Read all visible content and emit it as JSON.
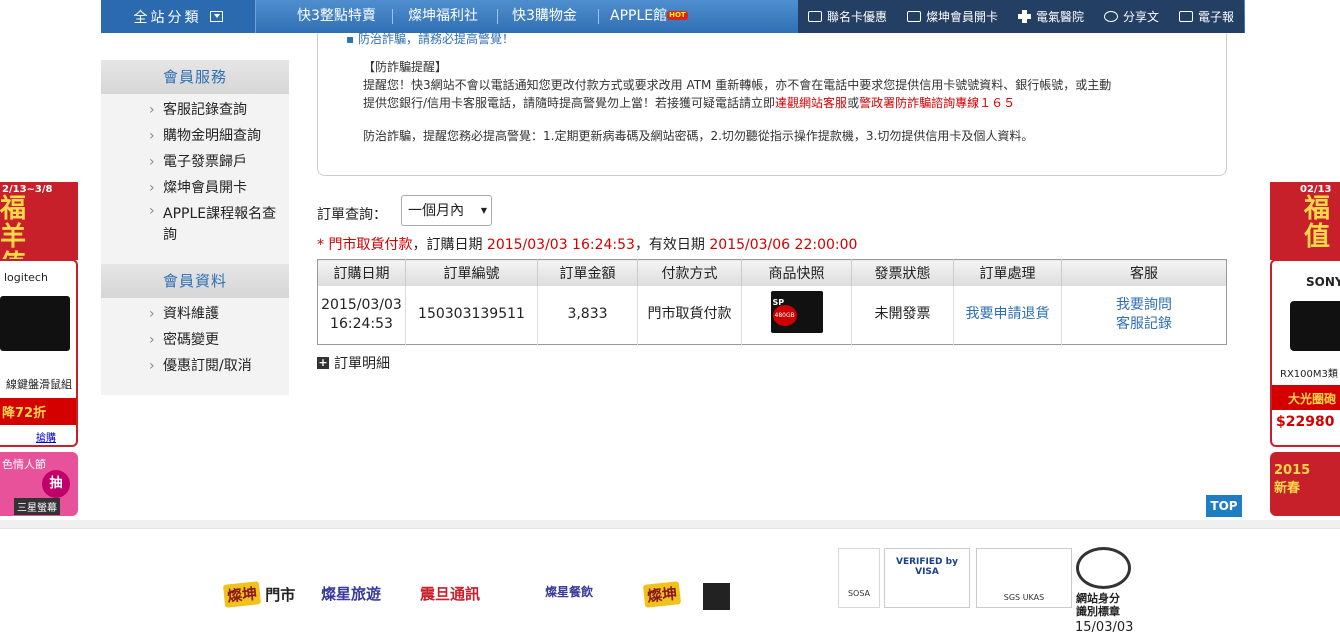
{
  "topnav": {
    "category": "全站分類",
    "items": [
      "快3整點特賣",
      "燦坤福利社",
      "快3購物金",
      "APPLE館"
    ],
    "hot": "HOT",
    "right": [
      "聯名卡優惠",
      "燦坤會員開卡",
      "電氣醫院",
      "分享文",
      "電子報"
    ]
  },
  "sidebar": {
    "service_title": "會員服務",
    "service_items": [
      "客服記錄查詢",
      "購物金明細查詢",
      "電子發票歸戶",
      "燦坤會員開卡",
      "APPLE課程報名查",
      "詢"
    ],
    "info_title": "會員資料",
    "info_items": [
      "資料維護",
      "密碼變更",
      "優惠訂閱/取消"
    ]
  },
  "notice": {
    "line0": "▪ 防治詐騙，請務必提高警覺！",
    "title": "【防詐騙提醒】",
    "line1": "提醒您！快3網站不會以電話通知您更改付款方式或要求改用 ATM 重新轉帳，亦不會在電話中要求您提供信用卡號號資料、銀行帳號，或主動",
    "line2a": "提供您銀行/信用卡客服電話，請隨時提高警覺勿上當！若接獲可疑電話請立即",
    "line2b": "達觀網站客服",
    "line2c": "或",
    "line2d": "警政署防詐騙諮詢專線１６５",
    "line3": "防治詐騙，提醒您務必提高警覺：1.定期更新病毒碼及網站密碼，2.切勿聽從指示操作提款機，3.切勿提供信用卡及個人資料。"
  },
  "query": {
    "label": "訂單查詢：",
    "selected": "一個月內"
  },
  "info": {
    "star": "* ",
    "payment": "門市取貨付款",
    "order_date_label": "，訂購日期 ",
    "order_date": "2015/03/03 16:24:53",
    "valid_label": "，有效日期 ",
    "valid_date": "2015/03/06 22:00:00"
  },
  "table": {
    "headers": [
      "訂購日期",
      "訂單編號",
      "訂單金額",
      "付款方式",
      "商品快照",
      "發票狀態",
      "訂單處理",
      "客服"
    ],
    "row": {
      "date": "2015/03/03",
      "time": "16:24:53",
      "order_no": "150303139511",
      "amount": "3,833",
      "payment": "門市取貨付款",
      "ssd_brand": "SP",
      "ssd_cap": "480GB",
      "invoice": "未開發票",
      "action": "我要申請退貨",
      "cs1": "我要詢問",
      "cs2": "客服記錄"
    }
  },
  "detail_label": "訂單明細",
  "top_label": "TOP",
  "footer": {
    "logos": [
      "燦坤",
      "門市",
      "燦星旅遊",
      "震旦通訊",
      "燦星餐飲",
      "燦坤"
    ],
    "badges": [
      "SOSA",
      "VERIFIED by VISA",
      "SGS",
      "UKAS"
    ],
    "id_label1": "網站身分",
    "id_label2": "識別標章",
    "date": "15/03/03"
  },
  "ads": {
    "left_date": "2/13~3/8",
    "left_title": "福羊值上",
    "left_brand": "logitech",
    "left_product": "線鍵盤滑鼠組",
    "left_price": "降72折",
    "left_link": "搶購",
    "left2_title": "色情人節",
    "left2_btn": "抽",
    "left2_sub": "三星螢幕",
    "right_date": "02/13",
    "right_title": "福值",
    "right_brand": "SONY",
    "right_product": "RX100M3類",
    "right_promo": "大光圈砲",
    "right_price": "$22980",
    "right2_title": "2015新春"
  },
  "colors": {
    "accent": "#2f6fb3",
    "alert": "#d40000",
    "navdark": "#233f63"
  }
}
